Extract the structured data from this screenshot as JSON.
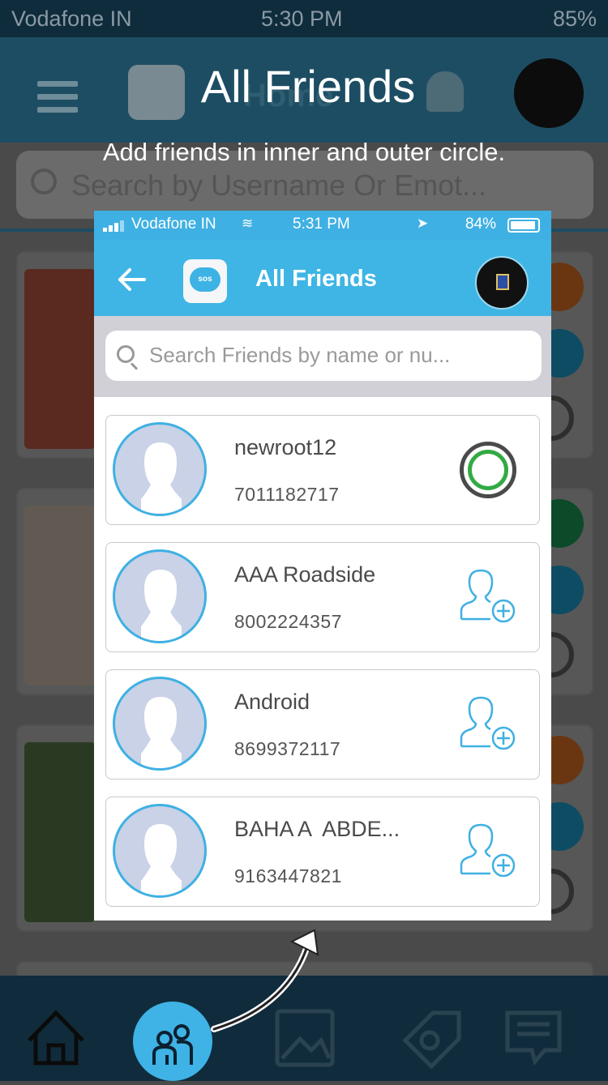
{
  "background": {
    "status": {
      "carrier": "Vodafone IN",
      "time": "5:30 PM",
      "battery": "85%"
    },
    "header": {
      "title": "Home"
    },
    "search": {
      "placeholder": "Search by Username Or Emot..."
    },
    "tabs": [
      "home-icon",
      "friends-icon",
      "gallery-icon",
      "tag-icon",
      "chat-icon"
    ]
  },
  "caption": {
    "title": "All Friends",
    "subtitle": "Add friends in inner and outer circle."
  },
  "phone": {
    "status": {
      "carrier": "Vodafone IN",
      "time": "5:31 PM",
      "battery": "84%"
    },
    "header": {
      "title": "All Friends",
      "logo_text": "sos"
    },
    "search": {
      "placeholder": "Search Friends by name or nu..."
    },
    "friends": [
      {
        "name": "newroot12",
        "phone": "7011182717",
        "action": "circle-status-icon"
      },
      {
        "name": "AAA Roadside",
        "phone": "8002224357",
        "action": "add-friend-icon"
      },
      {
        "name": "Android",
        "phone": "8699372117",
        "action": "add-friend-icon"
      },
      {
        "name": "BAHA A  ABDE...",
        "phone": "9163447821",
        "action": "add-friend-icon"
      }
    ]
  },
  "colors": {
    "accent": "#3fb5e5",
    "status_ring": "#33aa44"
  }
}
